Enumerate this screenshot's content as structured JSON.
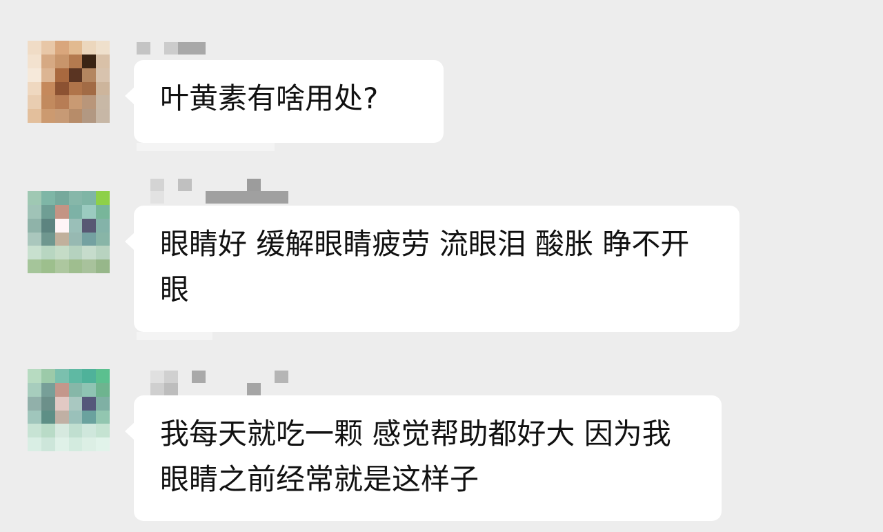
{
  "chat": {
    "messages": [
      {
        "text": "叶黄素有啥用处?"
      },
      {
        "text": "眼睛好 缓解眼睛疲劳 流眼泪 酸胀 睁不开眼"
      },
      {
        "text": "我每天就吃一颗 感觉帮助都好大 因为我眼睛之前经常就是这样子"
      }
    ]
  },
  "colors": {
    "background": "#ededed",
    "bubble": "#ffffff",
    "text": "#111111"
  }
}
